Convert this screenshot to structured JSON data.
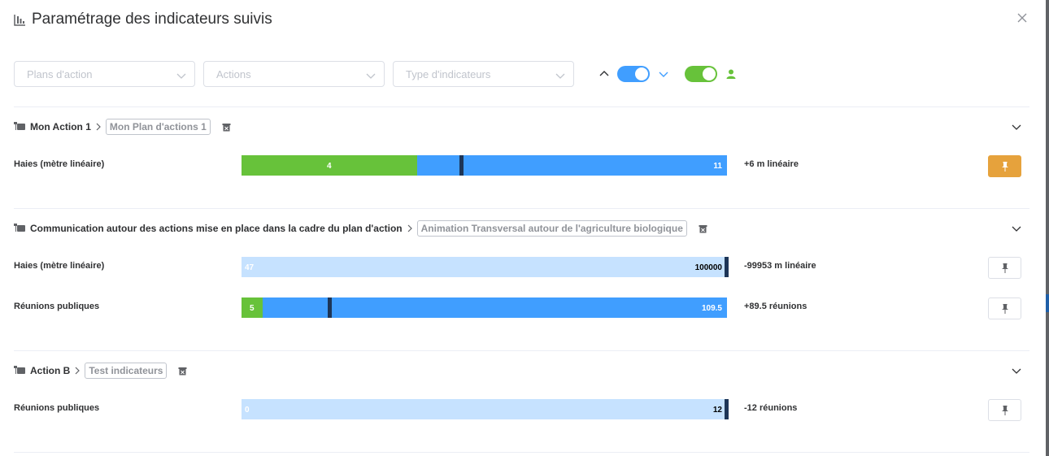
{
  "dialog": {
    "title": "Paramétrage des indicateurs suivis"
  },
  "filters": {
    "plans_placeholder": "Plans d'action",
    "actions_placeholder": "Actions",
    "type_placeholder": "Type d'indicateurs"
  },
  "toggles": {
    "expand_all_on": true,
    "mine_only_on": true,
    "colors": {
      "blue": "#409eff",
      "green": "#67c23a"
    }
  },
  "sections": [
    {
      "action": "Mon Action 1",
      "plan": "Mon Plan d'actions 1",
      "indicators": [
        {
          "label": "Haies (mètre linéaire)",
          "start": "4",
          "target": "11",
          "delta": "+6 m linéaire",
          "current_fraction": 0.36,
          "progress_fraction": 0.45,
          "pinned": true
        }
      ]
    },
    {
      "action": "Communication autour des actions mise en place dans la cadre du plan d'action",
      "plan": "Animation Transversal autour de l'agriculture biologique",
      "indicators": [
        {
          "label": "Haies (mètre linéaire)",
          "start": "47",
          "target": "100000",
          "delta": "-99953 m linéaire",
          "current_fraction": 0.0,
          "progress_fraction": 0.0,
          "pinned": false
        },
        {
          "label": "Réunions publiques",
          "start": "5",
          "target": "109.5",
          "delta": "+89.5 réunions",
          "current_fraction": 0.043,
          "progress_fraction": 0.185,
          "pinned": false
        }
      ]
    },
    {
      "action": "Action B",
      "plan": "Test indicateurs",
      "indicators": [
        {
          "label": "Réunions publiques",
          "start": "0",
          "target": "12",
          "delta": "-12 réunions",
          "current_fraction": 0.0,
          "progress_fraction": 0.0,
          "pinned": false
        }
      ]
    }
  ],
  "colors": {
    "accent_orange": "#e6a23c",
    "bar_light": "#c6e2ff",
    "bar_blue": "#409eff",
    "bar_green": "#67c23a",
    "marker": "#1d3557"
  }
}
